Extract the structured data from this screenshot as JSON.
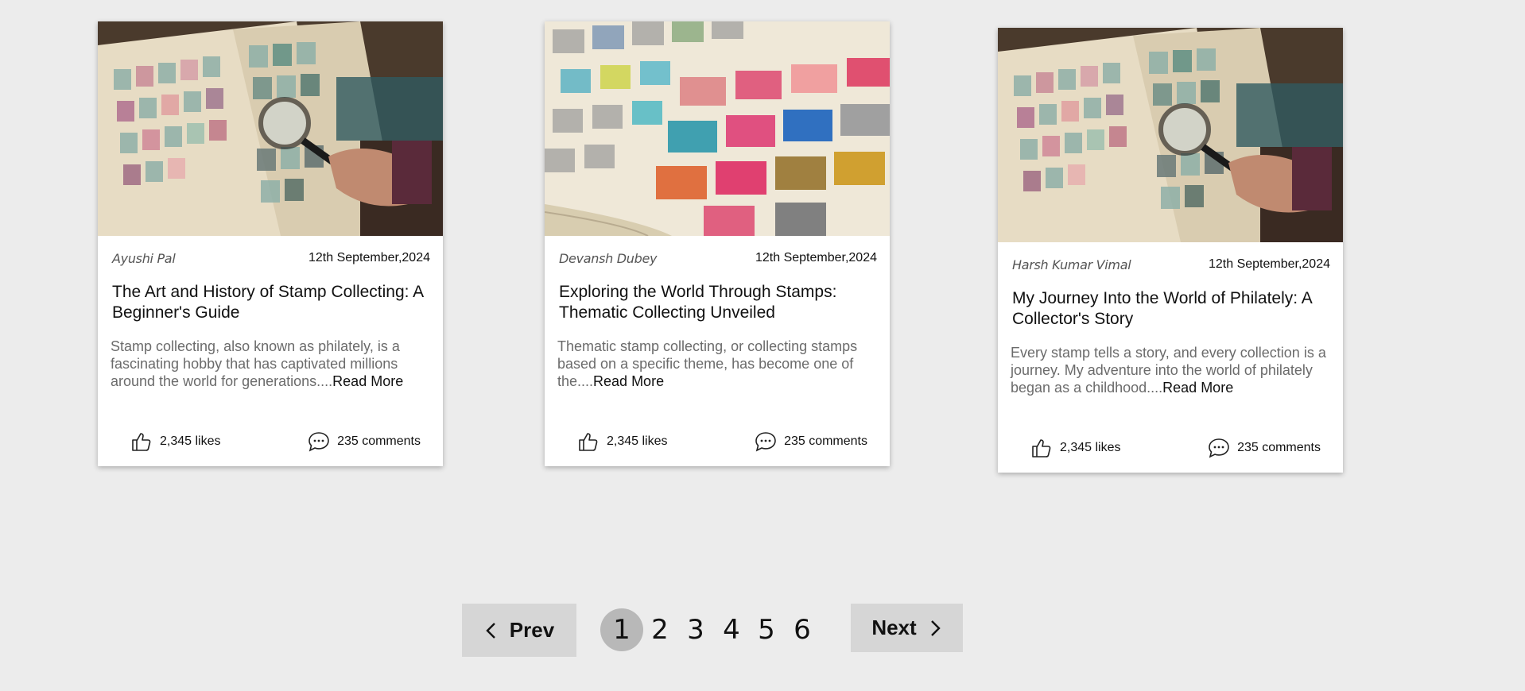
{
  "cards": [
    {
      "author": "Ayushi Pal",
      "date": "12th September,2024",
      "title": "The Art and History of Stamp Collecting: A Beginner's Guide",
      "excerpt": "Stamp collecting, also known as philately, is a fascinating hobby that has captivated millions around the world for generations....",
      "read_more": "Read More",
      "likes": "2,345 likes",
      "comments": "235 comments",
      "image_icon": "stamp-album-magnifier-image"
    },
    {
      "author": "Devansh Dubey",
      "date": "12th September,2024",
      "title": "Exploring the World Through Stamps: Thematic Collecting Unveiled",
      "excerpt": "Thematic stamp collecting, or collecting stamps based on a specific theme, has become one of the....",
      "read_more": "Read More",
      "likes": "2,345 likes",
      "comments": "235 comments",
      "image_icon": "stamp-album-pages-image"
    },
    {
      "author": "Harsh Kumar Vimal",
      "date": "12th September,2024",
      "title": "My Journey Into the World of Philately: A Collector's Story",
      "excerpt": "Every stamp tells a story, and every collection is a journey. My adventure into the world of philately began as a childhood....",
      "read_more": "Read More",
      "likes": "2,345 likes",
      "comments": "235 comments",
      "image_icon": "stamp-album-magnifier-image"
    }
  ],
  "pagination": {
    "prev_label": "Prev",
    "next_label": "Next",
    "pages": [
      "1",
      "2",
      "3",
      "4",
      "5",
      "6"
    ],
    "current_page": "1"
  },
  "colors": {
    "background": "#ececec",
    "card": "#ffffff",
    "pager_button": "#d6d6d6",
    "active_page": "#b8b8b8"
  }
}
